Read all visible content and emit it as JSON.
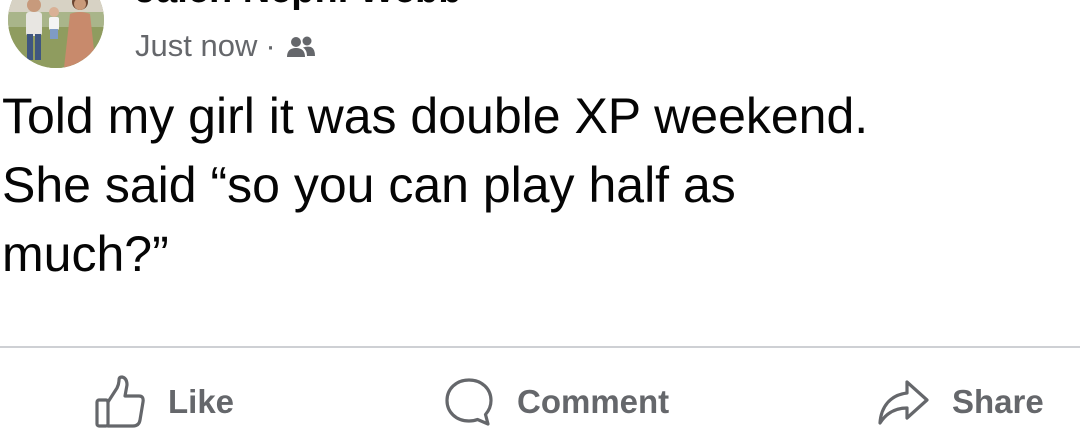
{
  "post": {
    "author": {
      "name": "Jalen Nephi Webb",
      "avatar_icon": "profile-photo"
    },
    "timestamp": "Just now",
    "separator": "·",
    "audience_icon": "friends-icon",
    "text_lines": [
      "Told my girl it was double XP weekend.",
      "She said “so you can play half as",
      "much?”"
    ]
  },
  "actions": {
    "like": {
      "label": "Like",
      "icon": "thumbs-up-icon"
    },
    "comment": {
      "label": "Comment",
      "icon": "comment-bubble-icon"
    },
    "share": {
      "label": "Share",
      "icon": "share-arrow-icon"
    }
  },
  "colors": {
    "text": "#050505",
    "secondary": "#65676b",
    "divider": "#ced0d4"
  }
}
